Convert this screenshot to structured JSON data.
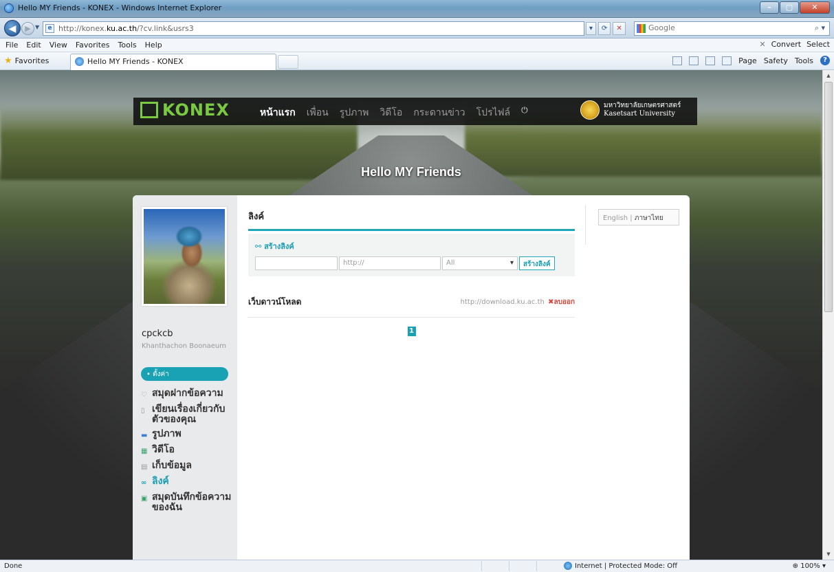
{
  "window": {
    "title": "Hello MY Friends - KONEX - Windows Internet Explorer",
    "buttons": {
      "minimize": "–",
      "maximize": "▢",
      "close": "✕"
    }
  },
  "address_bar": {
    "url_prefix": "http://konex.",
    "url_domain": "ku.ac.th",
    "url_suffix": "/?cv.link&usrs3",
    "refresh": "⟳",
    "stop": "✕",
    "search_provider": "Google",
    "search_placeholder": "Google"
  },
  "menu_bar": {
    "items": [
      "File",
      "Edit",
      "View",
      "Favorites",
      "Tools",
      "Help"
    ],
    "convert": "Convert",
    "select": "Select"
  },
  "favorites_bar": {
    "favorites": "Favorites",
    "tab_title": "Hello MY Friends - KONEX",
    "commands": [
      "Page",
      "Safety",
      "Tools"
    ]
  },
  "site": {
    "logo": "KONEX",
    "nav": [
      {
        "label": "หน้าแรก",
        "active": true
      },
      {
        "label": "เพื่อน",
        "active": false
      },
      {
        "label": "รูปภาพ",
        "active": false
      },
      {
        "label": "วิดีโอ",
        "active": false
      },
      {
        "label": "กระดานข่าว",
        "active": false
      },
      {
        "label": "โปรไฟล์",
        "active": false
      }
    ],
    "power": "⏻",
    "university_th": "มหาวิทยาลัยเกษตรศาสตร์",
    "university_en": "Kasetsart University",
    "hero_title": "Hello MY Friends"
  },
  "profile": {
    "username": "cpckcb",
    "fullname": "Khanthachon Boonaeum",
    "settings_label": "• ตั้งค่า",
    "menu": [
      {
        "label": "สมุดฝากข้อความ",
        "icon": "heart-icon",
        "active": false
      },
      {
        "label": "เขียนเรื่องเกี่ยวกับตัวของคุณ",
        "icon": "document-icon",
        "active": false
      },
      {
        "label": "รูปภาพ",
        "icon": "image-icon",
        "active": false
      },
      {
        "label": "วิดีโอ",
        "icon": "video-icon",
        "active": false
      },
      {
        "label": "เก็บข้อมูล",
        "icon": "storage-icon",
        "active": false
      },
      {
        "label": "ลิงค์",
        "icon": "link-icon",
        "active": true
      },
      {
        "label": "สมุดบันทึกข้อความของฉัน",
        "icon": "notebook-icon",
        "active": false
      }
    ]
  },
  "links_page": {
    "heading": "ลิงค์",
    "create_label": "สร้างลิงค์",
    "name_value": "",
    "url_placeholder": "http://",
    "category_selected": "All",
    "create_button": "สร้างลิงค์",
    "items": [
      {
        "title": "เว็บดาวน์โหลด",
        "url": "http://download.ku.ac.th",
        "delete": "ลบออก"
      }
    ],
    "current_page": "1"
  },
  "language": {
    "english": "English",
    "separator": "|",
    "thai": "ภาษาไทย"
  },
  "status_bar": {
    "status": "Done",
    "zone": "Internet | Protected Mode: Off",
    "zoom": "100%"
  },
  "colors": {
    "accent": "#19a2b4",
    "logo_green": "#7ac943",
    "delete_red": "#d9453a"
  }
}
